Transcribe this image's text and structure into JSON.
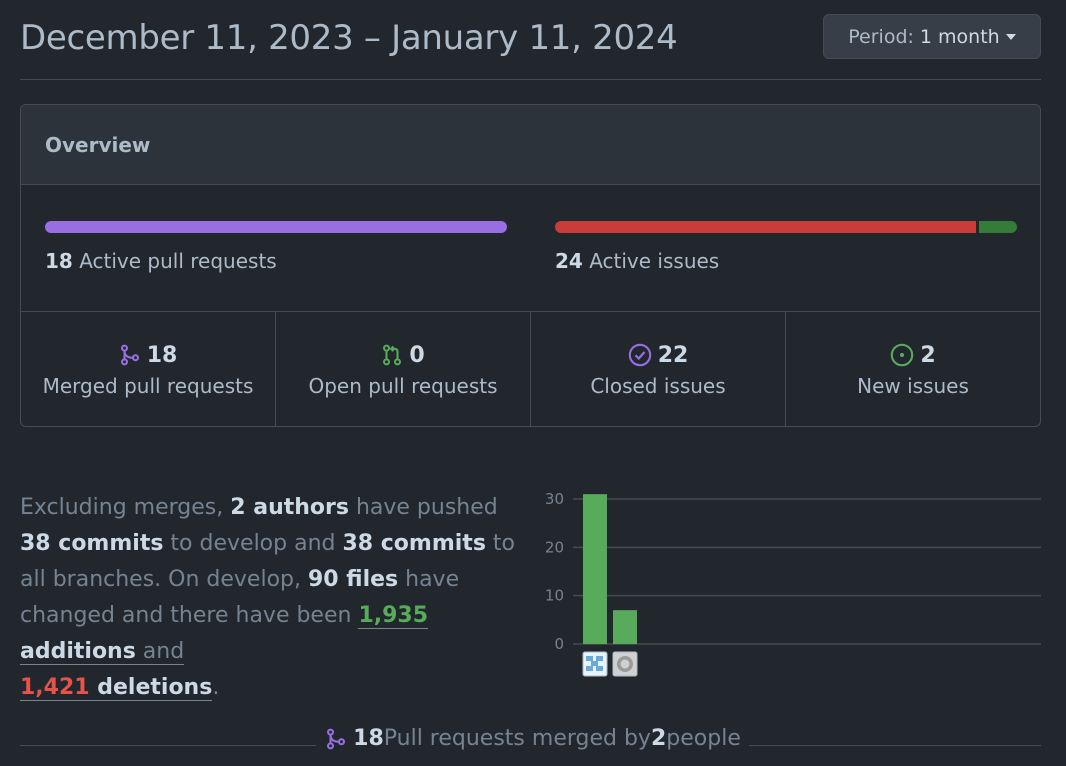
{
  "header": {
    "date_range": "December 11, 2023 – January 11, 2024",
    "period_label": "Period:",
    "period_value": "1 month"
  },
  "overview": {
    "title": "Overview",
    "pull_requests": {
      "count": "18",
      "label": "Active pull requests",
      "merged_fraction": 1.0,
      "open_fraction": 0.0
    },
    "issues": {
      "count": "24",
      "label": "Active issues",
      "closed_fraction": 0.9167,
      "new_fraction": 0.0833
    },
    "stats": [
      {
        "value": "18",
        "label": "Merged pull requests",
        "icon": "merge-icon",
        "color": "#986ee2"
      },
      {
        "value": "0",
        "label": "Open pull requests",
        "icon": "pull-request-icon",
        "color": "#57ab5a"
      },
      {
        "value": "22",
        "label": "Closed issues",
        "icon": "check-circle-icon",
        "color": "#986ee2"
      },
      {
        "value": "2",
        "label": "New issues",
        "icon": "issue-opened-icon",
        "color": "#57ab5a"
      }
    ]
  },
  "summary": {
    "s1": "Excluding merges, ",
    "authors": "2 authors",
    "s2": " have pushed ",
    "commits_develop": "38 commits",
    "s3": " to develop and ",
    "commits_all": "38 commits",
    "s4": " to all branches. On develop, ",
    "files": "90 files",
    "s5": " have changed and there have been ",
    "additions_count": "1,935",
    "additions_word": " additions",
    "s6": " and",
    "deletions_count": "1,421",
    "deletions_word": " deletions",
    "s7": "."
  },
  "chart_data": {
    "type": "bar",
    "categories": [
      "author-1",
      "author-2"
    ],
    "values": [
      31,
      7
    ],
    "yticks": [
      "30",
      "20",
      "10",
      "0"
    ],
    "ylim": [
      0,
      30
    ],
    "bar_color": "#57ab5a"
  },
  "footer": {
    "count": "18",
    "text": " Pull requests merged by ",
    "people_count": "2",
    "people_word": " people"
  },
  "colors": {
    "merged": "#986ee2",
    "closed_issue": "#c93c37",
    "new_issue": "#347d39"
  }
}
